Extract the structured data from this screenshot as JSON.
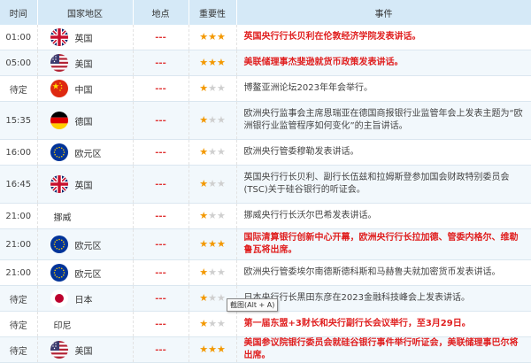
{
  "header": {
    "time": "时间",
    "country": "国家地区",
    "place": "地点",
    "importance": "重要性",
    "event": "事件"
  },
  "rows": [
    {
      "time": "01:00",
      "country": "英国",
      "flag": "uk-flag-icon",
      "place": "---",
      "stars": 3,
      "event": "英国央行行长贝利在伦敦经济学院发表讲话。",
      "important": true
    },
    {
      "time": "05:00",
      "country": "美国",
      "flag": "us-flag-icon",
      "place": "---",
      "stars": 3,
      "event": "美联储理事杰斐逊就货币政策发表讲话。",
      "important": true
    },
    {
      "time": "待定",
      "country": "中国",
      "flag": "cn-flag-icon",
      "place": "---",
      "stars": 1,
      "event": "博鳌亚洲论坛2023年年会举行。",
      "important": false
    },
    {
      "time": "15:35",
      "country": "德国",
      "flag": "de-flag-icon",
      "place": "---",
      "stars": 1,
      "event": "欧洲央行监事会主席恩瑞亚在德国商报银行业监管年会上发表主题为“欧洲银行业监管程序如何变化”的主旨讲话。",
      "important": false
    },
    {
      "time": "16:00",
      "country": "欧元区",
      "flag": "eu-flag-icon",
      "place": "---",
      "stars": 1,
      "event": "欧洲央行管委穆勒发表讲话。",
      "important": false
    },
    {
      "time": "16:45",
      "country": "英国",
      "flag": "uk-flag-icon",
      "place": "---",
      "stars": 1,
      "event": "英国央行行长贝利、副行长伍兹和拉姆斯登参加国会财政特别委员会(TSC)关于硅谷银行的听证会。",
      "important": false
    },
    {
      "time": "21:00",
      "country": "挪威",
      "flag": "",
      "place": "---",
      "stars": 1,
      "event": "挪威央行行长沃尔巴希发表讲话。",
      "important": false
    },
    {
      "time": "21:00",
      "country": "欧元区",
      "flag": "eu-flag-icon",
      "place": "---",
      "stars": 3,
      "event": "国际清算银行创新中心开幕，欧洲央行行长拉加德、管委内格尔、维勒鲁瓦将出席。",
      "important": true
    },
    {
      "time": "21:00",
      "country": "欧元区",
      "flag": "eu-flag-icon",
      "place": "---",
      "stars": 1,
      "event": "欧洲央行管委埃尔南德斯德科斯和马赫鲁夫就加密货币发表讲话。",
      "important": false
    },
    {
      "time": "待定",
      "country": "日本",
      "flag": "jp-flag-icon",
      "place": "---",
      "stars": 1,
      "event": "日本央行行长黑田东彦在2023金融科技峰会上发表讲话。",
      "important": false
    },
    {
      "time": "待定",
      "country": "印尼",
      "flag": "",
      "place": "---",
      "stars": 1,
      "event": "第一届东盟+3财长和央行副行长会议举行，至3月29日。",
      "important": true
    },
    {
      "time": "待定",
      "country": "美国",
      "flag": "us-flag-icon",
      "place": "---",
      "stars": 3,
      "event": "美国参议院银行委员会就硅谷银行事件举行听证会，美联储理事巴尔将出席。",
      "important": true
    }
  ],
  "tooltip": "截图(Alt + A)",
  "colors": {
    "star_on": "#f39800",
    "star_off": "#cfcfcf",
    "important_text": "#e02020",
    "header_bg": "#d5e9f7"
  }
}
